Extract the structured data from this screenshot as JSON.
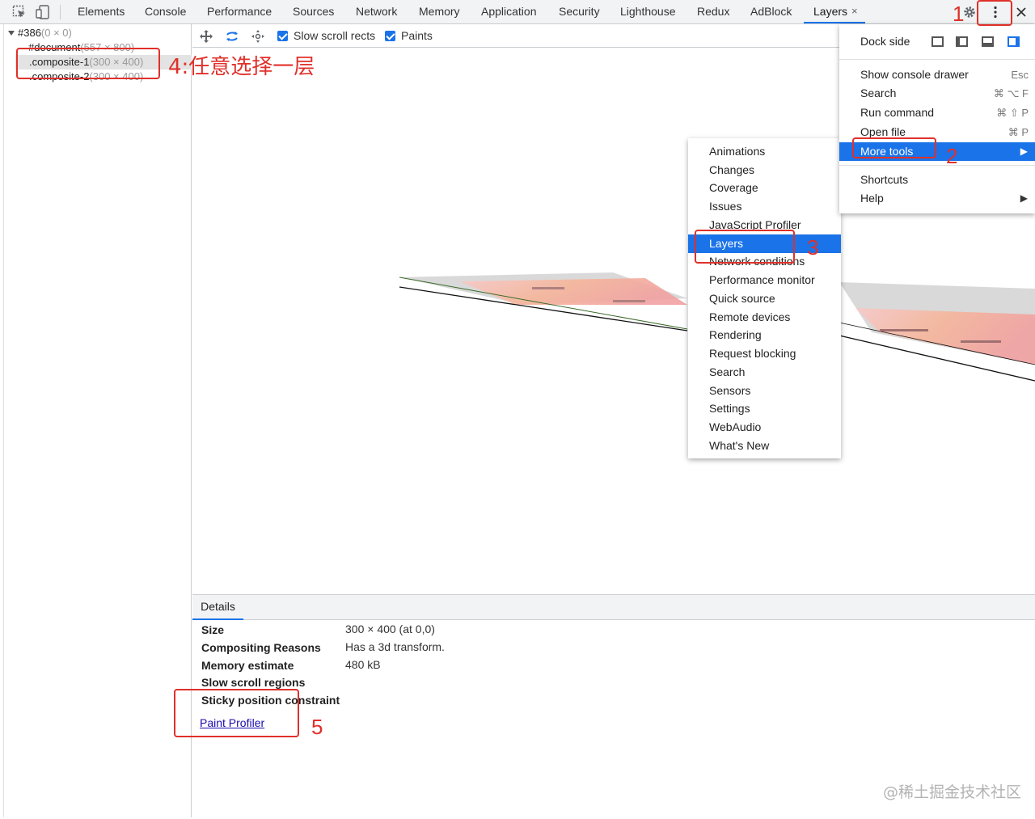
{
  "tabs": [
    {
      "label": "Elements"
    },
    {
      "label": "Console"
    },
    {
      "label": "Performance"
    },
    {
      "label": "Sources"
    },
    {
      "label": "Network"
    },
    {
      "label": "Memory"
    },
    {
      "label": "Application"
    },
    {
      "label": "Security"
    },
    {
      "label": "Lighthouse"
    },
    {
      "label": "Redux"
    },
    {
      "label": "AdBlock"
    },
    {
      "label": "Layers",
      "active": true
    }
  ],
  "tab_close_glyph": "×",
  "layer_tree": {
    "root": {
      "name": "#386",
      "size": "(0 × 0)"
    },
    "items": [
      {
        "name": "#document",
        "size": "(557 × 800)"
      },
      {
        "name": ".composite-1",
        "size": "(300 × 400)",
        "selected": true
      },
      {
        "name": ".composite-2",
        "size": "(300 × 400)"
      }
    ]
  },
  "layers_toolbar": {
    "slow_scroll_rects": "Slow scroll rects",
    "paints": "Paints"
  },
  "details": {
    "tab_label": "Details",
    "rows": [
      {
        "label": "Size",
        "value": "300 × 400 (at 0,0)"
      },
      {
        "label": "Compositing Reasons",
        "value": "Has a 3d transform."
      },
      {
        "label": "Memory estimate",
        "value": "480 kB"
      },
      {
        "label": "Slow scroll regions",
        "value": ""
      },
      {
        "label": "Sticky position constraint",
        "value": ""
      }
    ],
    "paint_profiler": "Paint Profiler"
  },
  "main_menu": {
    "dock_side": "Dock side",
    "items": [
      {
        "label": "Show console drawer",
        "shortcut": "Esc"
      },
      {
        "label": "Search",
        "shortcut": "⌘ ⌥ F"
      },
      {
        "label": "Run command",
        "shortcut": "⌘ ⇧ P"
      },
      {
        "label": "Open file",
        "shortcut": "⌘ P"
      },
      {
        "label": "More tools",
        "arrow": "▶",
        "highlighted": true
      }
    ],
    "items2": [
      {
        "label": "Shortcuts"
      },
      {
        "label": "Help",
        "arrow": "▶"
      }
    ]
  },
  "more_tools": [
    "Animations",
    "Changes",
    "Coverage",
    "Issues",
    "JavaScript Profiler",
    "Layers",
    "Network conditions",
    "Performance monitor",
    "Quick source",
    "Remote devices",
    "Rendering",
    "Request blocking",
    "Search",
    "Sensors",
    "Settings",
    "WebAudio",
    "What's New"
  ],
  "more_tools_highlighted": "Layers",
  "annotations": {
    "n1": "1",
    "n2": "2",
    "n3": "3",
    "n4": "4:任意选择一层",
    "n5": "5"
  },
  "watermark": "@稀土掘金技术社区",
  "colors": {
    "accent": "#1a73e8",
    "annotation": "#e0302a",
    "toolbar_bg": "#f1f3f4"
  }
}
